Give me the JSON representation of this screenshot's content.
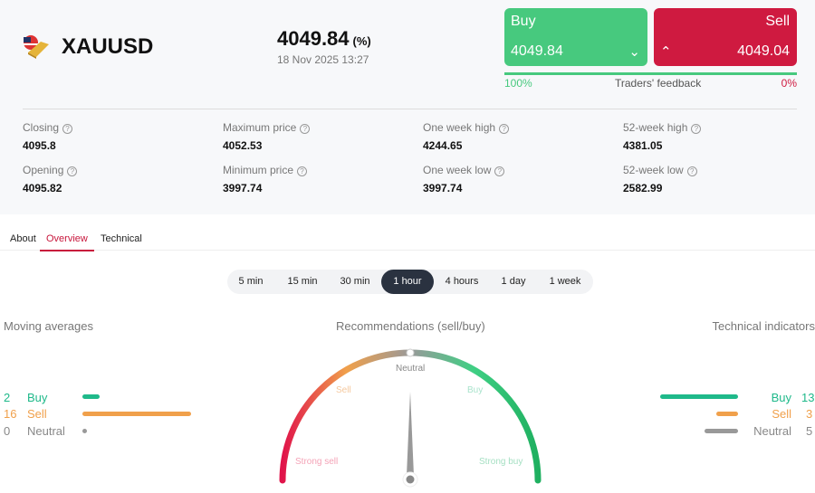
{
  "instrument": {
    "symbol": "XAUUSD",
    "price": "4049.84",
    "change": "(%)",
    "datetime": "18 Nov 2025 13:27"
  },
  "trade": {
    "buy_label": "Buy",
    "buy_price": "4049.84",
    "sell_label": "Sell",
    "sell_price": "4049.04",
    "feedback_label": "Traders' feedback",
    "buy_pct": "100%",
    "sell_pct": "0%",
    "buy_fraction": 1.0
  },
  "stats": [
    {
      "label": "Closing",
      "value": "4095.8"
    },
    {
      "label": "Maximum price",
      "value": "4052.53"
    },
    {
      "label": "One week high",
      "value": "4244.65"
    },
    {
      "label": "52-week high",
      "value": "4381.05"
    },
    {
      "label": "Opening",
      "value": "4095.82"
    },
    {
      "label": "Minimum price",
      "value": "3997.74"
    },
    {
      "label": "One week low",
      "value": "3997.74"
    },
    {
      "label": "52-week low",
      "value": "2582.99"
    }
  ],
  "tabs": [
    "About",
    "Overview",
    "Technical"
  ],
  "periods": [
    "5 min",
    "15 min",
    "30 min",
    "1 hour",
    "4 hours",
    "1 day",
    "1 week"
  ],
  "moving_averages": {
    "title": "Moving averages",
    "rows": [
      {
        "count": "2",
        "label": "Buy"
      },
      {
        "count": "16",
        "label": "Sell"
      },
      {
        "count": "0",
        "label": "Neutral"
      }
    ]
  },
  "gauge": {
    "title": "Recommendations (sell/buy)",
    "labels": [
      "Strong sell",
      "Sell",
      "Neutral",
      "Buy",
      "Strong buy"
    ],
    "needle_value": 0.5
  },
  "technical": {
    "title": "Technical indicators",
    "rows": [
      {
        "count": "13",
        "label": "Buy"
      },
      {
        "count": "3",
        "label": "Sell"
      },
      {
        "count": "5",
        "label": "Neutral"
      }
    ]
  },
  "colors": {
    "buy": "#47c97e",
    "sell": "#cf1a40",
    "orange": "#f0a04b",
    "teal": "#1fb98a"
  }
}
